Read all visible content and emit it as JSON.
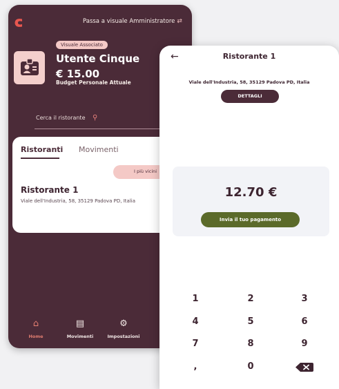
{
  "back_screen": {
    "switch_label": "Passa a visuale Amministratore",
    "role_badge": "Visuale Associato",
    "user_name": "Utente Cinque",
    "budget_amount": "€ 15.00",
    "budget_label": "Budget Personale Attuale",
    "search_placeholder": "Cerca il ristorante",
    "tabs": [
      {
        "label": "Ristoranti",
        "active": true
      },
      {
        "label": "Movimenti",
        "active": false
      }
    ],
    "filter_chip": "I più vicini",
    "restaurant": {
      "name": "Ristorante 1",
      "address": "Viale dell'Industria, 58, 35129 Padova PD, Italia"
    },
    "nav": [
      {
        "label": "Home",
        "icon": "home-icon"
      },
      {
        "label": "Movimenti",
        "icon": "wallet-icon"
      },
      {
        "label": "Impostazioni",
        "icon": "gear-icon"
      }
    ]
  },
  "front_screen": {
    "title": "Ristorante 1",
    "address": "Viale dell'Industria, 58, 35129 Padova PD, Italia",
    "details_label": "DETTAGLI",
    "amount": "12.70 €",
    "send_label": "Invia il tuo pagamento",
    "keys": [
      "1",
      "2",
      "3",
      "4",
      "5",
      "6",
      "7",
      "8",
      "9",
      ",",
      "0"
    ]
  },
  "colors": {
    "primary": "#4b2b38",
    "accent_pink": "#f4c9c6",
    "accent_red": "#e07d70",
    "olive": "#5b6a2a"
  }
}
